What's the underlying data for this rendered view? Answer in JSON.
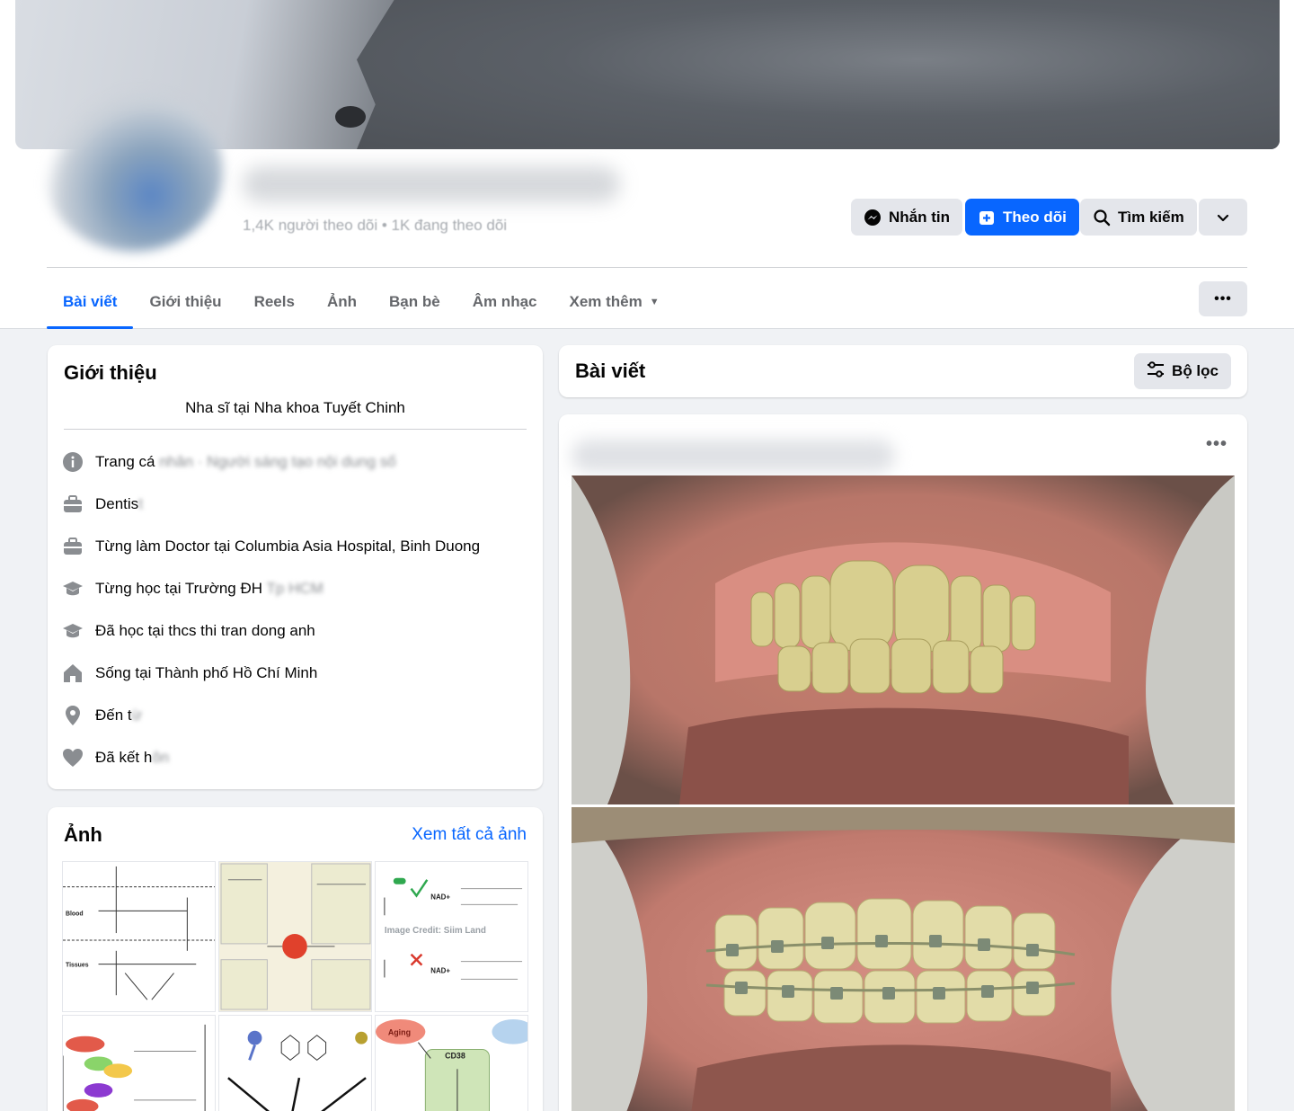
{
  "profile": {
    "followers_text": "1,4K người theo dõi • 1K đang theo dõi"
  },
  "header_buttons": {
    "message": "Nhắn tin",
    "follow": "Theo dõi",
    "search": "Tìm kiếm"
  },
  "tabs": [
    "Bài viết",
    "Giới thiệu",
    "Reels",
    "Ảnh",
    "Bạn bè",
    "Âm nhạc",
    "Xem thêm"
  ],
  "intro": {
    "title": "Giới thiệu",
    "bio": "Nha sĩ tại Nha khoa Tuyết Chinh",
    "rows": [
      {
        "icon": "info-icon",
        "text": "Trang cá",
        "blurred": "nhân · Người sáng tạo nội dung số"
      },
      {
        "icon": "briefcase-icon",
        "text": "Dentis",
        "blurred": "t"
      },
      {
        "icon": "briefcase-icon",
        "text": "Từng làm Doctor tại Columbia Asia Hospital, Binh Duong",
        "blurred": ""
      },
      {
        "icon": "graduation-cap-icon",
        "text": "Từng học tại Trường ĐH",
        "blurred": "Tp HCM"
      },
      {
        "icon": "graduation-cap-icon",
        "text": "Đã học tại thcs thi tran dong anh",
        "blurred": ""
      },
      {
        "icon": "home-icon",
        "text": "Sống tại Thành phố Hồ Chí Minh",
        "blurred": ""
      },
      {
        "icon": "location-pin-icon",
        "text": "Đến t",
        "blurred": "ừ"
      },
      {
        "icon": "heart-icon",
        "text": "Đã kết h",
        "blurred": "ôn"
      }
    ]
  },
  "photos": {
    "title": "Ảnh",
    "see_all": "Xem tất cả ảnh",
    "thumb_texts": {
      "t1_blood": "Blood",
      "t1_tissues": "Tissues",
      "t3_credit": "Image Credit: Siim Land",
      "t3_nad": "NAD+",
      "t6_aging": "Aging",
      "t6_cd38": "CD38"
    }
  },
  "posts": {
    "title": "Bài viết",
    "filter": "Bộ lọc"
  },
  "colors": {
    "accent": "#0866ff",
    "page_bg": "#f0f2f5",
    "button_bg": "#e4e6eb"
  }
}
